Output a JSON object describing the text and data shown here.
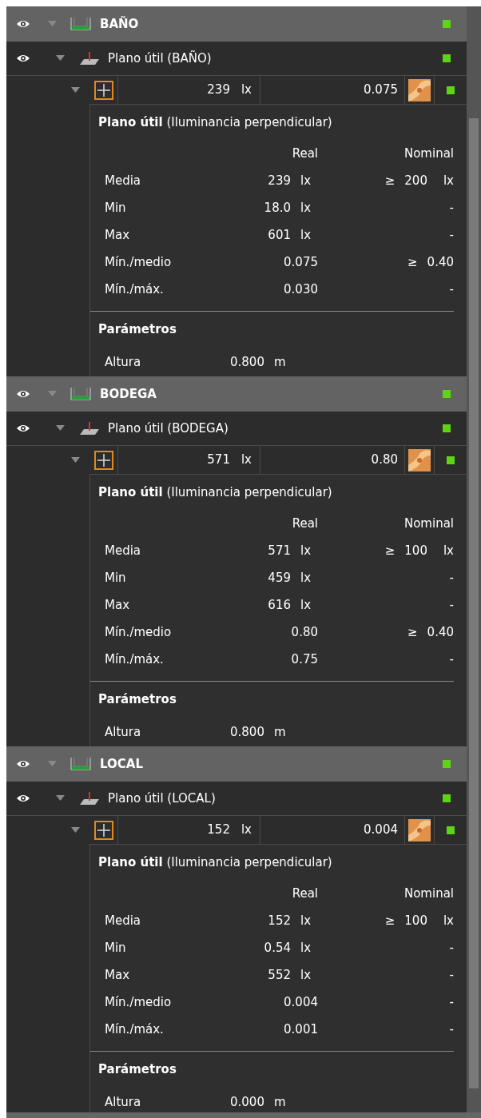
{
  "sections": [
    {
      "name": "BAÑO",
      "visible": true,
      "expanded": true,
      "plane": {
        "label": "Plano útil (BAÑO)",
        "visible": true,
        "expanded": true
      },
      "summary": {
        "expanded": true,
        "average": "239",
        "average_unit": "lx",
        "ratio": "0.075"
      },
      "detail": {
        "title": "**Plano útil** (Iluminancia perpendicular)",
        "columns": [
          "Real",
          "Nominal"
        ],
        "rows": [
          {
            "label": "Media",
            "real": "239",
            "real_unit": "lx",
            "operator": "≥",
            "nominal": "200",
            "nominal_unit": "lx"
          },
          {
            "label": "Min",
            "real": "18.0",
            "real_unit": "lx",
            "nominal": "-"
          },
          {
            "label": "Max",
            "real": "601",
            "real_unit": "lx",
            "nominal": "-"
          },
          {
            "label": "Mín./medio",
            "real": "0.075",
            "operator": "≥",
            "nominal": "0.40"
          },
          {
            "label": "Mín./máx.",
            "real": "0.030",
            "nominal": "-"
          }
        ],
        "params_title": "Parámetros",
        "params": [
          {
            "label": "Altura",
            "value": "0.800",
            "unit": "m"
          }
        ]
      }
    },
    {
      "name": "BODEGA",
      "visible": true,
      "expanded": true,
      "plane": {
        "label": "Plano útil (BODEGA)",
        "visible": true,
        "expanded": true
      },
      "summary": {
        "expanded": true,
        "average": "571",
        "average_unit": "lx",
        "ratio": "0.80"
      },
      "detail": {
        "title": "**Plano útil** (Iluminancia perpendicular)",
        "columns": [
          "Real",
          "Nominal"
        ],
        "rows": [
          {
            "label": "Media",
            "real": "571",
            "real_unit": "lx",
            "operator": "≥",
            "nominal": "100",
            "nominal_unit": "lx"
          },
          {
            "label": "Min",
            "real": "459",
            "real_unit": "lx",
            "nominal": "-"
          },
          {
            "label": "Max",
            "real": "616",
            "real_unit": "lx",
            "nominal": "-"
          },
          {
            "label": "Mín./medio",
            "real": "0.80",
            "operator": "≥",
            "nominal": "0.40"
          },
          {
            "label": "Mín./máx.",
            "real": "0.75",
            "nominal": "-"
          }
        ],
        "params_title": "Parámetros",
        "params": [
          {
            "label": "Altura",
            "value": "0.800",
            "unit": "m"
          }
        ]
      }
    },
    {
      "name": "LOCAL",
      "visible": true,
      "expanded": true,
      "plane": {
        "label": "Plano útil (LOCAL)",
        "visible": true,
        "expanded": true
      },
      "summary": {
        "expanded": true,
        "average": "152",
        "average_unit": "lx",
        "ratio": "0.004"
      },
      "detail": {
        "title": "**Plano útil** (Iluminancia perpendicular)",
        "columns": [
          "Real",
          "Nominal"
        ],
        "rows": [
          {
            "label": "Media",
            "real": "152",
            "real_unit": "lx",
            "operator": "≥",
            "nominal": "100",
            "nominal_unit": "lx"
          },
          {
            "label": "Min",
            "real": "0.54",
            "real_unit": "lx",
            "nominal": "-"
          },
          {
            "label": "Max",
            "real": "552",
            "real_unit": "lx",
            "nominal": "-"
          },
          {
            "label": "Mín./medio",
            "real": "0.004",
            "nominal": "-"
          },
          {
            "label": "Mín./máx.",
            "real": "0.001",
            "nominal": "-"
          }
        ],
        "params_title": "Parámetros",
        "params": [
          {
            "label": "Altura",
            "value": "0.000",
            "unit": "m"
          }
        ]
      }
    }
  ]
}
